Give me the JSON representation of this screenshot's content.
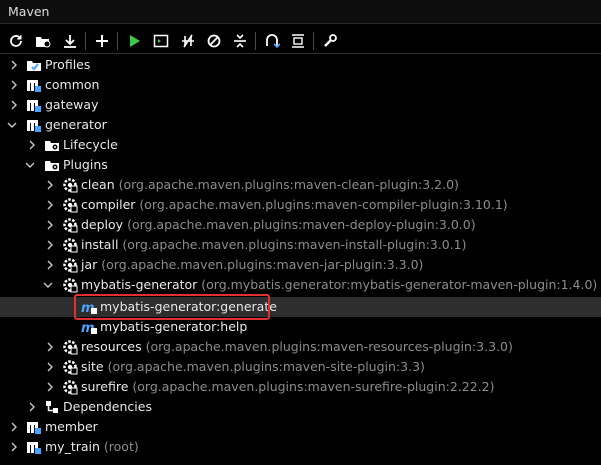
{
  "window": {
    "title": "Maven"
  },
  "toolbar": [
    {
      "icon": "reload-icon"
    },
    {
      "icon": "generate-sources-icon"
    },
    {
      "icon": "download-icon"
    },
    {
      "icon": "add-icon"
    },
    {
      "icon": "run-icon"
    },
    {
      "icon": "run-config-icon"
    },
    {
      "icon": "toggle-offline-icon"
    },
    {
      "icon": "skip-tests-icon"
    },
    {
      "icon": "collapse-all-icon"
    },
    {
      "icon": "show-dependencies-icon"
    },
    {
      "icon": "expand-all-icon"
    },
    {
      "icon": "settings-icon"
    }
  ],
  "colors": {
    "background": "#000000",
    "text": "#e8e8e8",
    "hint": "#8c8c8c",
    "highlight": "#e03030",
    "maven_blue": "#4aa3ff",
    "run_green": "#3ec94a"
  },
  "tree": {
    "profiles": "Profiles",
    "common": "common",
    "gateway": "gateway",
    "generator": "generator",
    "lifecycle": "Lifecycle",
    "plugins": "Plugins",
    "plugin_items": [
      {
        "name": "clean",
        "coord": "(org.apache.maven.plugins:maven-clean-plugin:3.2.0)"
      },
      {
        "name": "compiler",
        "coord": "(org.apache.maven.plugins:maven-compiler-plugin:3.10.1)"
      },
      {
        "name": "deploy",
        "coord": "(org.apache.maven.plugins:maven-deploy-plugin:3.0.0)"
      },
      {
        "name": "install",
        "coord": "(org.apache.maven.plugins:maven-install-plugin:3.0.1)"
      },
      {
        "name": "jar",
        "coord": "(org.apache.maven.plugins:maven-jar-plugin:3.3.0)"
      },
      {
        "name": "mybatis-generator",
        "coord": "(org.mybatis.generator:mybatis-generator-maven-plugin:1.4.0)"
      }
    ],
    "goals": [
      {
        "name": "mybatis-generator:generate",
        "selected": true
      },
      {
        "name": "mybatis-generator:help",
        "selected": false
      }
    ],
    "plugin_items_after": [
      {
        "name": "resources",
        "coord": "(org.apache.maven.plugins:maven-resources-plugin:3.3.0)"
      },
      {
        "name": "site",
        "coord": "(org.apache.maven.plugins:maven-site-plugin:3.3)"
      },
      {
        "name": "surefire",
        "coord": "(org.apache.maven.plugins:maven-surefire-plugin:2.22.2)"
      }
    ],
    "dependencies": "Dependencies",
    "member": "member",
    "my_train": "my_train",
    "my_train_hint": "(root)"
  }
}
